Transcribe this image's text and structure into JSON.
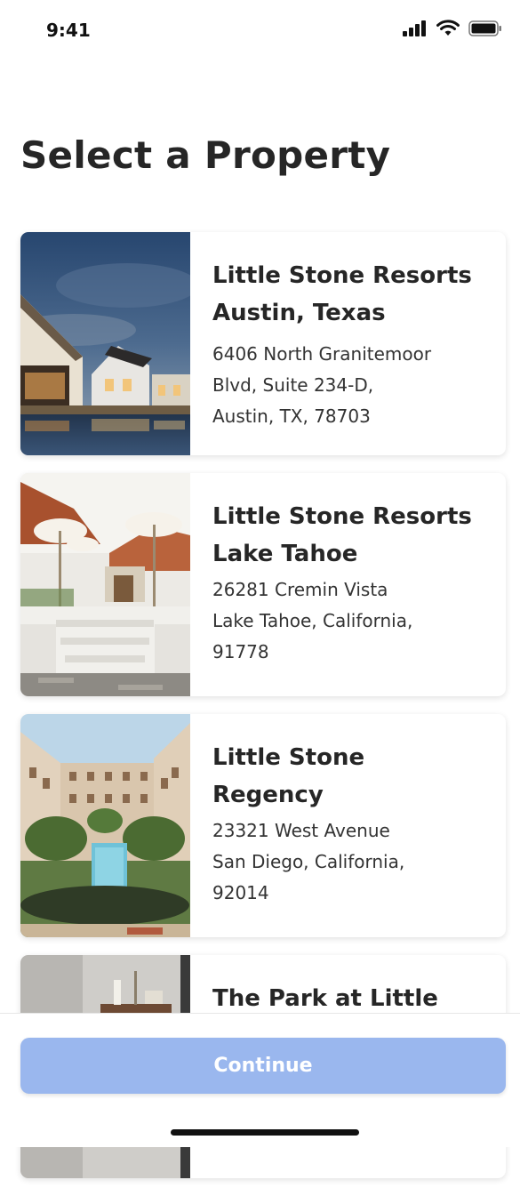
{
  "status_bar": {
    "time": "9:41"
  },
  "page": {
    "title": "Select a Property"
  },
  "properties": [
    {
      "name_line1": "Little Stone Resorts",
      "name_line2": "Austin, Texas",
      "addr_line1": "6406 North Granitemoor",
      "addr_line2": "Blvd, Suite 234-D,",
      "addr_line3": "Austin, TX, 78703"
    },
    {
      "name_line1": "Little Stone Resorts",
      "name_line2": "Lake Tahoe",
      "addr_line1": "26281 Cremin Vista",
      "addr_line2": "Lake Tahoe, California,",
      "addr_line3": "91778"
    },
    {
      "name_line1": "Little Stone",
      "name_line2": "Regency",
      "addr_line1": "23321 West Avenue",
      "addr_line2": "San Diego, California,",
      "addr_line3": "92014"
    },
    {
      "name_line1": "The Park at Little"
    }
  ],
  "footer": {
    "continue_label": "Continue"
  },
  "colors": {
    "button_bg": "#9ab7ee",
    "button_text": "#ffffff",
    "title": "#262626"
  },
  "icons": [
    "signal-icon",
    "wifi-icon",
    "battery-icon"
  ]
}
